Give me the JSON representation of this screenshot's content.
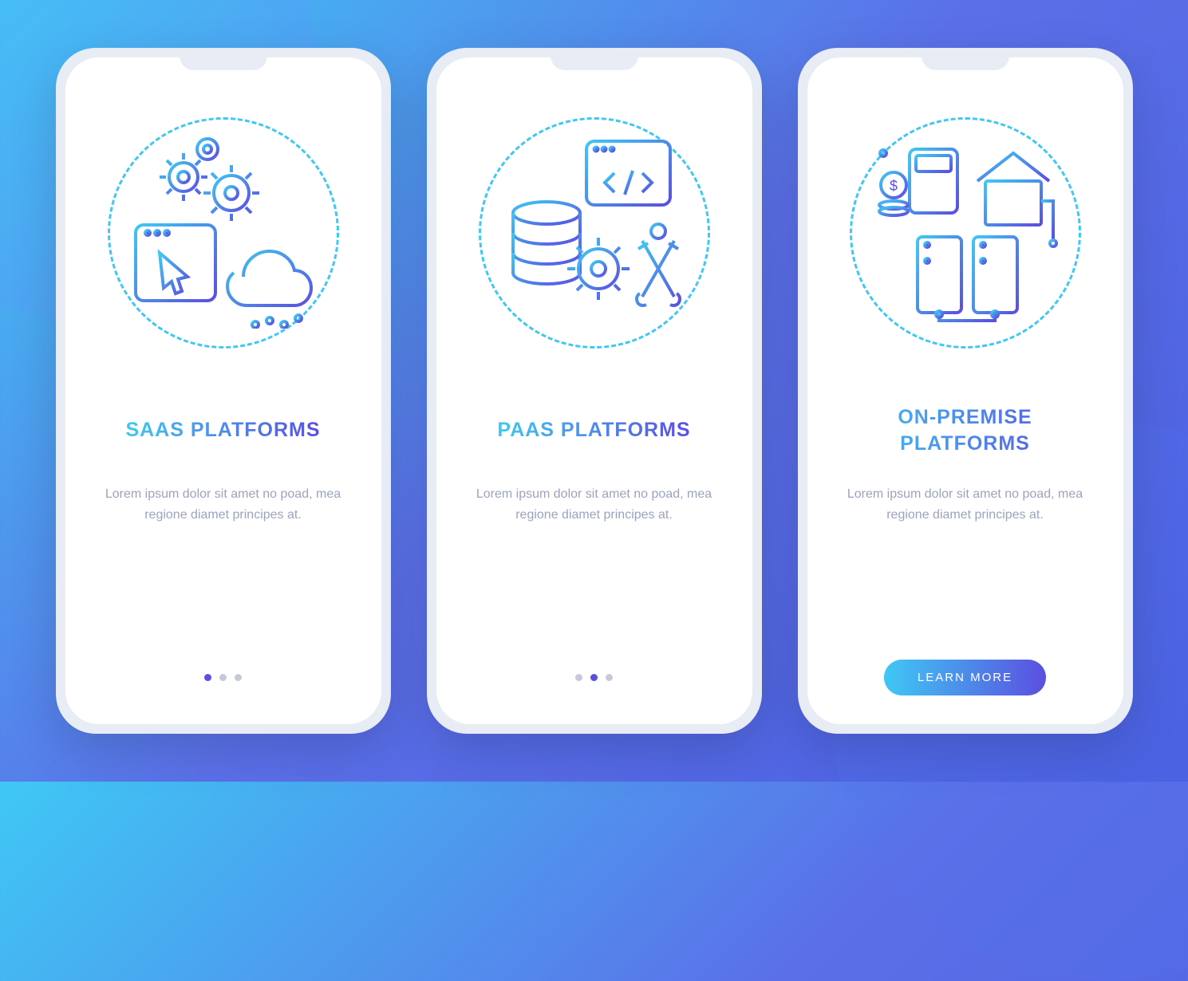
{
  "screens": [
    {
      "title": "SAAS PLATFORMS",
      "body": "Lorem ipsum dolor sit amet no poad, mea regione diamet principes at.",
      "icon": "gears-cloud",
      "activeDot": 0
    },
    {
      "title": "PAAS PLATFORMS",
      "body": "Lorem ipsum dolor sit amet no poad, mea regione diamet principes at.",
      "icon": "db-tools",
      "activeDot": 1
    },
    {
      "title": "ON-PREMISE PLATFORMS",
      "body": "Lorem ipsum dolor sit amet no poad, mea regione diamet principes at.",
      "icon": "servers-building",
      "cta": "LEARN MORE"
    }
  ],
  "colors": {
    "gradientStart": "#3FC8F4",
    "gradientEnd": "#5B4FE0",
    "textMuted": "#9CA3BF"
  }
}
